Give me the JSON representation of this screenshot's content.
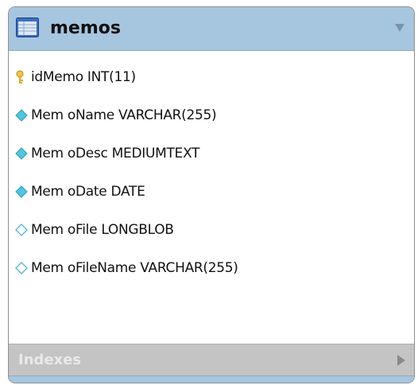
{
  "table": {
    "title": "memos",
    "header_color": "#a6c6e0",
    "icon": "table-icon"
  },
  "columns": [
    {
      "text": "idMemo INT(11)",
      "icon": "primary-key-icon"
    },
    {
      "text": "Mem oName VARCHAR(255)",
      "icon": "filled-diamond-icon"
    },
    {
      "text": "Mem oDesc MEDIUMTEXT",
      "icon": "filled-diamond-icon"
    },
    {
      "text": "Mem oDate DATE",
      "icon": "filled-diamond-icon"
    },
    {
      "text": "Mem oFile LONGBLOB",
      "icon": "hollow-diamond-icon"
    },
    {
      "text": "Mem oFileName VARCHAR(255)",
      "icon": "hollow-diamond-icon"
    }
  ],
  "indexes": {
    "label": "Indexes",
    "icon": "expand-arrow-icon"
  }
}
